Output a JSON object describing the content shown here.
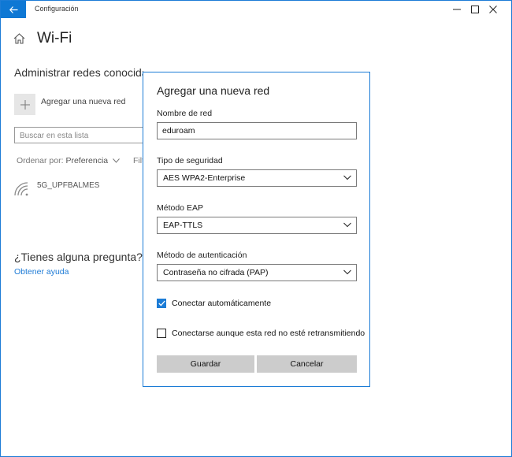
{
  "window": {
    "title": "Configuración",
    "accent": "#0f78d4"
  },
  "page": {
    "title": "Wi-Fi",
    "section_title": "Administrar redes conocidas",
    "add_network_label": "Agregar una nueva red",
    "search_placeholder": "Buscar en esta lista",
    "sort_label": "Ordenar por:",
    "sort_value": "Preferencia",
    "filter_label": "Filtrar por:",
    "networks": [
      {
        "name": "5G_UPFBALMES"
      }
    ],
    "question": "¿Tienes alguna pregunta?",
    "help_link": "Obtener ayuda"
  },
  "dialog": {
    "title": "Agregar una nueva red",
    "network_name_label": "Nombre de red",
    "network_name_value": "eduroam",
    "security_label": "Tipo de seguridad",
    "security_value": "AES WPA2-Enterprise",
    "eap_label": "Método EAP",
    "eap_value": "EAP-TTLS",
    "auth_label": "Método de autenticación",
    "auth_value": "Contraseña no cifrada (PAP)",
    "auto_connect_label": "Conectar automáticamente",
    "auto_connect_checked": true,
    "hidden_label": "Conectarse aunque esta red no esté retransmitiendo",
    "hidden_checked": false,
    "save_label": "Guardar",
    "cancel_label": "Cancelar"
  },
  "icons": {
    "back": "back-arrow-icon",
    "home": "home-icon",
    "add": "plus-icon",
    "wifi": "wifi-icon",
    "chevron": "chevron-down-icon",
    "check": "checkmark-icon"
  }
}
